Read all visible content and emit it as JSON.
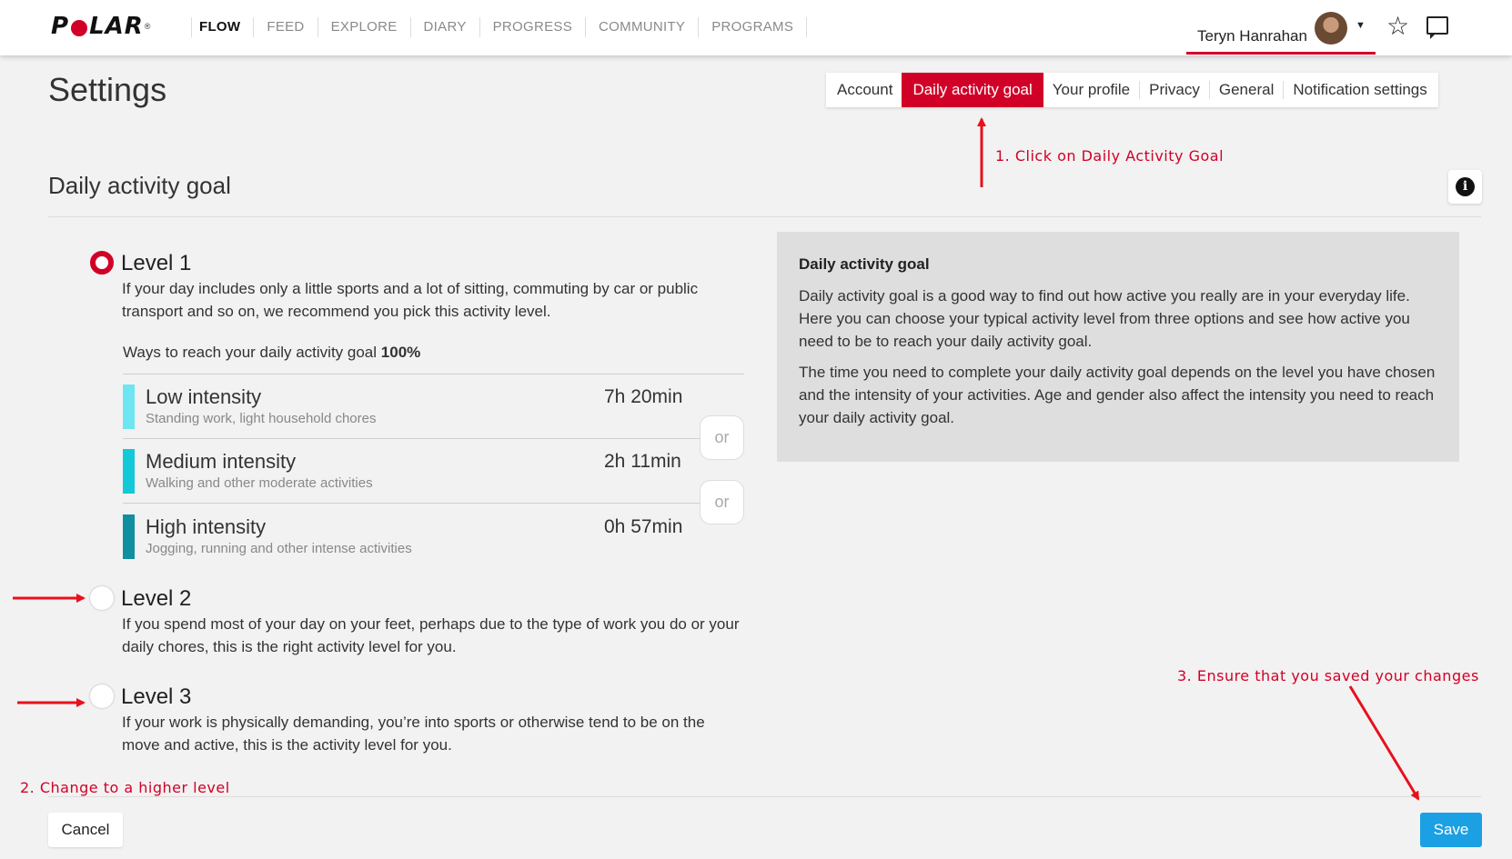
{
  "brand": {
    "logo_text_1": "P",
    "logo_text_2": "LAR",
    "logo_mark": "®"
  },
  "nav": {
    "items": [
      "FLOW",
      "FEED",
      "EXPLORE",
      "DIARY",
      "PROGRESS",
      "COMMUNITY",
      "PROGRAMS"
    ]
  },
  "user": {
    "name": "Teryn Hanrahan"
  },
  "page": {
    "title": "Settings",
    "section_title": "Daily activity goal"
  },
  "tabs": [
    "Account",
    "Daily activity goal",
    "Your profile",
    "Privacy",
    "General",
    "Notification settings"
  ],
  "active_tab": "Daily activity goal",
  "levels": [
    {
      "title": "Level 1",
      "selected": true,
      "description": "If your day includes only a little sports and a lot of sitting, commuting by car or public transport and so on, we recommend you pick this activity level."
    },
    {
      "title": "Level 2",
      "selected": false,
      "description": "If you spend most of your day on your feet, perhaps due to the type of work you do or your daily chores, this is the right activity level for you."
    },
    {
      "title": "Level 3",
      "selected": false,
      "description": "If your work is physically demanding, you’re into sports or otherwise tend to be on the move and active, this is the activity level for you."
    }
  ],
  "ways": {
    "label": "Ways to reach your daily activity goal",
    "value": "100%"
  },
  "intensities": [
    {
      "name": "Low intensity",
      "sub": "Standing work, light household chores",
      "time": "7h 20min",
      "color": "#6ee6f2"
    },
    {
      "name": "Medium intensity",
      "sub": "Walking and other moderate activities",
      "time": "2h 11min",
      "color": "#14c8d8"
    },
    {
      "name": "High intensity",
      "sub": "Jogging, running and other intense activities",
      "time": "0h 57min",
      "color": "#0f8fa0"
    }
  ],
  "or_label": "or",
  "info_panel": {
    "title": "Daily activity goal",
    "p1": "Daily activity goal is a good way to find out how active you really are in your everyday life. Here you can choose your typical activity level from three options and see how active you need to be to reach your daily activity goal.",
    "p2": "The time you need to complete your daily activity goal depends on the level you have chosen and the intensity of your activities. Age and gender also affect the intensity you need to reach your daily activity goal."
  },
  "annotations": {
    "step1": "1.  Click on Daily Activity Goal",
    "step2": "2. Change to a higher level",
    "step3": "3. Ensure that you saved your changes"
  },
  "buttons": {
    "cancel": "Cancel",
    "save": "Save"
  },
  "colors": {
    "brand_red": "#d10027",
    "save_blue": "#1aa0e3",
    "annotation_red": "#e8101c"
  }
}
